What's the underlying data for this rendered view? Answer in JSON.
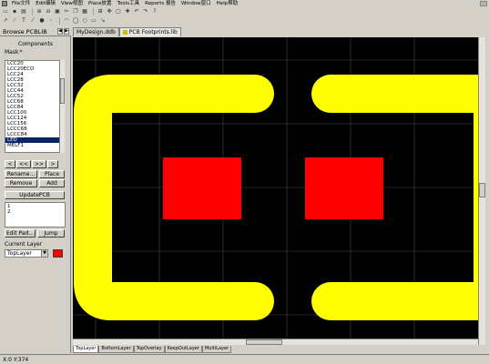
{
  "menu": {
    "items": [
      "File文件",
      "Edit编辑",
      "View视图",
      "Place放置",
      "Tools工具",
      "Reports 报告",
      "Window窗口",
      "Help帮助"
    ]
  },
  "toolbar": {
    "row1_icons": [
      "open-icon",
      "save-icon",
      "print-icon",
      "zoom-in-icon",
      "zoom-out-icon",
      "zoom-fit-icon",
      "cut-icon",
      "copy-icon",
      "paste-icon",
      "select-icon",
      "move-icon",
      "deselect-icon",
      "cross-icon",
      "undo-icon",
      "redo-icon",
      "help-icon"
    ],
    "row2_icons": [
      "arrow-icon",
      "line-icon",
      "text-icon",
      "string-icon",
      "pad-icon",
      "via-icon",
      "arc-icon",
      "fill-icon",
      "circle-icon",
      "region-icon",
      "pointer-icon"
    ]
  },
  "left_panel": {
    "title": "Browse PCBLIB",
    "components_label": "Components",
    "mask_label": "Mask",
    "mask_value": "*",
    "components": [
      "LCC20",
      "LCC20ECO",
      "LCC24",
      "LCC28",
      "LCC32",
      "LCC44",
      "LCC52",
      "LCC68",
      "LCC84",
      "LCC100",
      "LCC124",
      "LCC156",
      "LCCC68",
      "LCCC84",
      "LED",
      "MELF1"
    ],
    "selected_component": "LED",
    "nav_first": "<",
    "nav_prev": "<<",
    "nav_next": ">>",
    "nav_last": ">",
    "rename_label": "Rename...",
    "place_label": "Place",
    "remove_label": "Remove",
    "add_label": "Add",
    "update_label": "UpdatePCB",
    "pads": [
      "1",
      "2"
    ],
    "edit_pad_label": "Edit Pad...",
    "jump_label": "Jump",
    "current_layer_label": "Current Layer",
    "current_layer_value": "TopLayer",
    "current_layer_color": "#ff0000"
  },
  "tabs": {
    "doc1": "MyDesign.ddb",
    "doc2": "PCB Footprints.lib"
  },
  "layer_tabs": [
    "TopLayer",
    "BottomLayer",
    "TopOverlay",
    "KeepOutLayer",
    "MultiLayer"
  ],
  "active_layer_tab": "TopLayer",
  "colors": {
    "silkscreen": "#ffff00",
    "pad": "#ff0000",
    "grid": "#4a4a4a",
    "background": "#000000"
  },
  "status": {
    "coords": "X:0 Y:374"
  }
}
